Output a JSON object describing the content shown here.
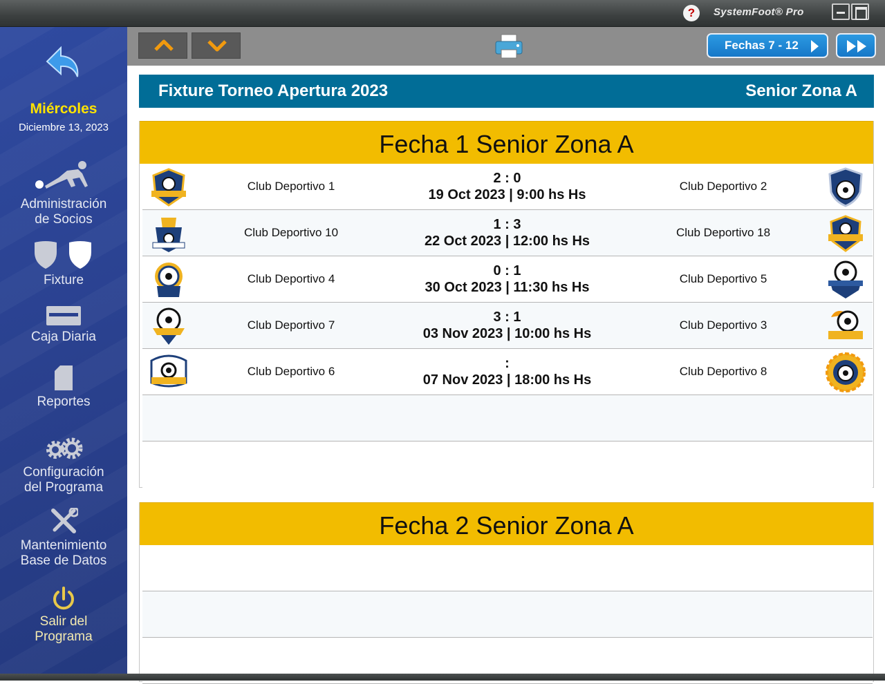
{
  "app": {
    "title": "SystemFoot® Pro",
    "help_label": "?"
  },
  "sidebar": {
    "day": "Miércoles",
    "date": "Diciembre 13, 2023",
    "items": [
      {
        "label_line1": "Administración",
        "label_line2": "de Socios",
        "icon": "player-icon"
      },
      {
        "label_line1": "Fixture",
        "label_line2": "",
        "icon": "shields-icon"
      },
      {
        "label_line1": "Caja Diaria",
        "label_line2": "",
        "icon": "cash-drawer-icon"
      },
      {
        "label_line1": "Reportes",
        "label_line2": "",
        "icon": "document-icon"
      },
      {
        "label_line1": "Configuración",
        "label_line2": "del Programa",
        "icon": "gears-icon"
      },
      {
        "label_line1": "Mantenimiento",
        "label_line2": "Base de Datos",
        "icon": "tools-icon"
      },
      {
        "label_line1": "Salir del",
        "label_line2": "Programa",
        "icon": "power-icon"
      }
    ]
  },
  "toolbar": {
    "fechas_label": "Fechas 7 - 12"
  },
  "header": {
    "title": "Fixture Torneo Apertura 2023",
    "zone": "Senior Zona A"
  },
  "fechas": [
    {
      "title": "Fecha 1 Senior Zona A",
      "matches": [
        {
          "home": "Club Deportivo 1",
          "away": "Club Deportivo 2",
          "score": "2 : 0",
          "datetime": "19 Oct 2023 | 9:00 hs Hs"
        },
        {
          "home": "Club Deportivo 10",
          "away": "Club Deportivo 18",
          "score": "1 : 3",
          "datetime": "22 Oct 2023 | 12:00 hs Hs"
        },
        {
          "home": "Club Deportivo 4",
          "away": "Club Deportivo 5",
          "score": "0 : 1",
          "datetime": "30 Oct 2023 | 11:30 hs Hs"
        },
        {
          "home": "Club Deportivo 7",
          "away": "Club Deportivo 3",
          "score": "3 : 1",
          "datetime": "03 Nov 2023 | 10:00 hs Hs"
        },
        {
          "home": "Club Deportivo 6",
          "away": "Club Deportivo 8",
          "score": ":",
          "datetime": "07 Nov 2023 | 18:00 hs Hs"
        }
      ]
    },
    {
      "title": "Fecha 2 Senior Zona A",
      "matches": []
    }
  ],
  "colors": {
    "header_bg": "#016d97",
    "fecha_bg": "#f2bc00",
    "sidebar_bg": "#2a418f",
    "day_color": "#ffe300",
    "button_blue": "#1f88d6"
  }
}
